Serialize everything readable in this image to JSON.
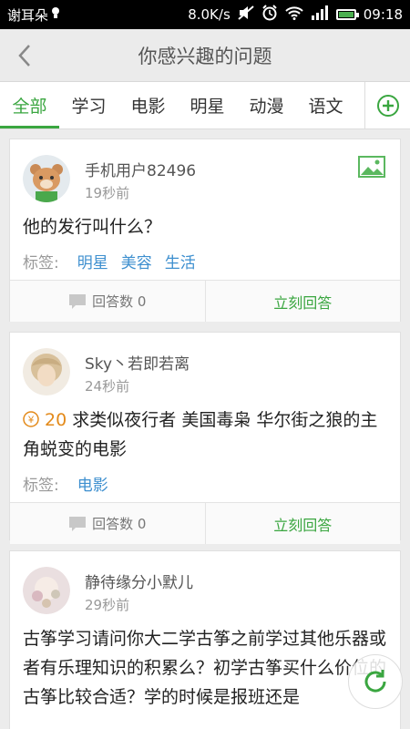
{
  "status_bar": {
    "carrier": "谢耳朵",
    "speed": "8.0K/s",
    "time": "09:18"
  },
  "header": {
    "title": "你感兴趣的问题"
  },
  "tabs": [
    {
      "label": "全部",
      "active": true
    },
    {
      "label": "学习",
      "active": false
    },
    {
      "label": "电影",
      "active": false
    },
    {
      "label": "明星",
      "active": false
    },
    {
      "label": "动漫",
      "active": false
    },
    {
      "label": "语文",
      "active": false
    }
  ],
  "questions": [
    {
      "user": "手机用户82496",
      "time": "19秒前",
      "has_image": true,
      "reward": "",
      "text": "他的发行叫什么？",
      "tag_label": "标签:",
      "tags": [
        "明星",
        "美容",
        "生活"
      ],
      "answer_count": "回答数 0",
      "answer_button": "立刻回答"
    },
    {
      "user": "Sky丶若即若离",
      "time": "24秒前",
      "has_image": false,
      "reward": "20",
      "text": "求类似夜行者 美国毒枭 华尔街之狼的主角蜕变的电影",
      "tag_label": "标签:",
      "tags": [
        "电影"
      ],
      "answer_count": "回答数 0",
      "answer_button": "立刻回答"
    },
    {
      "user": "静待缘分小默儿",
      "time": "29秒前",
      "has_image": false,
      "reward": "",
      "text": "古筝学习请问你大二学古筝之前学过其他乐器或者有乐理知识的积累么？初学古筝买什么价位的古筝比较合适？学的时候是报班还是"
    }
  ],
  "colors": {
    "accent": "#3aa640",
    "tag": "#3d8fcf",
    "reward": "#e38a1a"
  }
}
